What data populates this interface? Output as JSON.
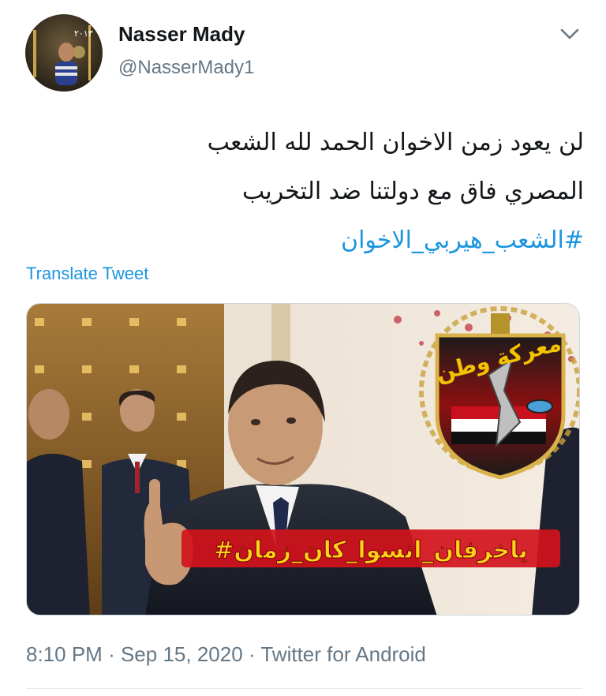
{
  "author": {
    "name": "Nasser Mady",
    "handle": "@NasserMady1",
    "avatar_caption": "٢٠١٣"
  },
  "tweet": {
    "text_lines": [
      "لن يعود زمن الاخوان الحمد لله الشعب",
      "المصري فاق مع دولتنا ضد التخريب"
    ],
    "hashtag": "#الشعب_هيربي_الاخوان"
  },
  "translate_label": "Translate Tweet",
  "media": {
    "badge_title": "معركة وطن",
    "overlay_hashtag": "#ياخرفان_انسوا_كان_زمان"
  },
  "meta": {
    "time": "8:10 PM",
    "separator": "·",
    "date": "Sep 15, 2020",
    "source": "Twitter for Android"
  },
  "colors": {
    "link": "#1b95e0",
    "secondary_text": "#657786",
    "overlay_text": "#ffd21a",
    "overlay_band": "#d3121b"
  }
}
